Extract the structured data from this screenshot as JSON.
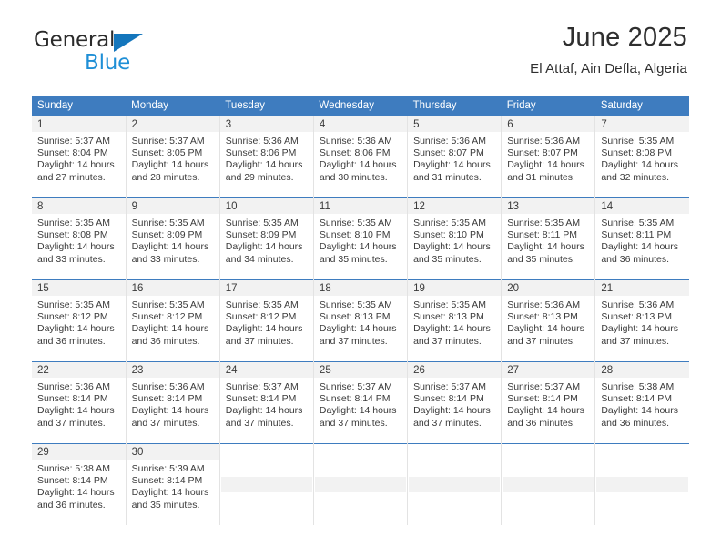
{
  "logo": {
    "name_part1": "General",
    "name_part2": "Blue",
    "triangle_color": "#1476bc",
    "text_color": "#2b2b2b",
    "blue_color": "#1f8fd6"
  },
  "header": {
    "title": "June 2025",
    "subtitle": "El Attaf, Ain Defla, Algeria"
  },
  "theme": {
    "header_row_bg": "#3e7cbf",
    "daynum_bg": "#f2f2f2",
    "grid_line": "#e3e3e3",
    "text": "#3a3a3a"
  },
  "weekday_headers": [
    "Sunday",
    "Monday",
    "Tuesday",
    "Wednesday",
    "Thursday",
    "Friday",
    "Saturday"
  ],
  "weeks": [
    {
      "days": [
        {
          "day": "1",
          "sunrise": "Sunrise: 5:37 AM",
          "sunset": "Sunset: 8:04 PM",
          "daylight1": "Daylight: 14 hours",
          "daylight2": "and 27 minutes."
        },
        {
          "day": "2",
          "sunrise": "Sunrise: 5:37 AM",
          "sunset": "Sunset: 8:05 PM",
          "daylight1": "Daylight: 14 hours",
          "daylight2": "and 28 minutes."
        },
        {
          "day": "3",
          "sunrise": "Sunrise: 5:36 AM",
          "sunset": "Sunset: 8:06 PM",
          "daylight1": "Daylight: 14 hours",
          "daylight2": "and 29 minutes."
        },
        {
          "day": "4",
          "sunrise": "Sunrise: 5:36 AM",
          "sunset": "Sunset: 8:06 PM",
          "daylight1": "Daylight: 14 hours",
          "daylight2": "and 30 minutes."
        },
        {
          "day": "5",
          "sunrise": "Sunrise: 5:36 AM",
          "sunset": "Sunset: 8:07 PM",
          "daylight1": "Daylight: 14 hours",
          "daylight2": "and 31 minutes."
        },
        {
          "day": "6",
          "sunrise": "Sunrise: 5:36 AM",
          "sunset": "Sunset: 8:07 PM",
          "daylight1": "Daylight: 14 hours",
          "daylight2": "and 31 minutes."
        },
        {
          "day": "7",
          "sunrise": "Sunrise: 5:35 AM",
          "sunset": "Sunset: 8:08 PM",
          "daylight1": "Daylight: 14 hours",
          "daylight2": "and 32 minutes."
        }
      ]
    },
    {
      "days": [
        {
          "day": "8",
          "sunrise": "Sunrise: 5:35 AM",
          "sunset": "Sunset: 8:08 PM",
          "daylight1": "Daylight: 14 hours",
          "daylight2": "and 33 minutes."
        },
        {
          "day": "9",
          "sunrise": "Sunrise: 5:35 AM",
          "sunset": "Sunset: 8:09 PM",
          "daylight1": "Daylight: 14 hours",
          "daylight2": "and 33 minutes."
        },
        {
          "day": "10",
          "sunrise": "Sunrise: 5:35 AM",
          "sunset": "Sunset: 8:09 PM",
          "daylight1": "Daylight: 14 hours",
          "daylight2": "and 34 minutes."
        },
        {
          "day": "11",
          "sunrise": "Sunrise: 5:35 AM",
          "sunset": "Sunset: 8:10 PM",
          "daylight1": "Daylight: 14 hours",
          "daylight2": "and 35 minutes."
        },
        {
          "day": "12",
          "sunrise": "Sunrise: 5:35 AM",
          "sunset": "Sunset: 8:10 PM",
          "daylight1": "Daylight: 14 hours",
          "daylight2": "and 35 minutes."
        },
        {
          "day": "13",
          "sunrise": "Sunrise: 5:35 AM",
          "sunset": "Sunset: 8:11 PM",
          "daylight1": "Daylight: 14 hours",
          "daylight2": "and 35 minutes."
        },
        {
          "day": "14",
          "sunrise": "Sunrise: 5:35 AM",
          "sunset": "Sunset: 8:11 PM",
          "daylight1": "Daylight: 14 hours",
          "daylight2": "and 36 minutes."
        }
      ]
    },
    {
      "days": [
        {
          "day": "15",
          "sunrise": "Sunrise: 5:35 AM",
          "sunset": "Sunset: 8:12 PM",
          "daylight1": "Daylight: 14 hours",
          "daylight2": "and 36 minutes."
        },
        {
          "day": "16",
          "sunrise": "Sunrise: 5:35 AM",
          "sunset": "Sunset: 8:12 PM",
          "daylight1": "Daylight: 14 hours",
          "daylight2": "and 36 minutes."
        },
        {
          "day": "17",
          "sunrise": "Sunrise: 5:35 AM",
          "sunset": "Sunset: 8:12 PM",
          "daylight1": "Daylight: 14 hours",
          "daylight2": "and 37 minutes."
        },
        {
          "day": "18",
          "sunrise": "Sunrise: 5:35 AM",
          "sunset": "Sunset: 8:13 PM",
          "daylight1": "Daylight: 14 hours",
          "daylight2": "and 37 minutes."
        },
        {
          "day": "19",
          "sunrise": "Sunrise: 5:35 AM",
          "sunset": "Sunset: 8:13 PM",
          "daylight1": "Daylight: 14 hours",
          "daylight2": "and 37 minutes."
        },
        {
          "day": "20",
          "sunrise": "Sunrise: 5:36 AM",
          "sunset": "Sunset: 8:13 PM",
          "daylight1": "Daylight: 14 hours",
          "daylight2": "and 37 minutes."
        },
        {
          "day": "21",
          "sunrise": "Sunrise: 5:36 AM",
          "sunset": "Sunset: 8:13 PM",
          "daylight1": "Daylight: 14 hours",
          "daylight2": "and 37 minutes."
        }
      ]
    },
    {
      "days": [
        {
          "day": "22",
          "sunrise": "Sunrise: 5:36 AM",
          "sunset": "Sunset: 8:14 PM",
          "daylight1": "Daylight: 14 hours",
          "daylight2": "and 37 minutes."
        },
        {
          "day": "23",
          "sunrise": "Sunrise: 5:36 AM",
          "sunset": "Sunset: 8:14 PM",
          "daylight1": "Daylight: 14 hours",
          "daylight2": "and 37 minutes."
        },
        {
          "day": "24",
          "sunrise": "Sunrise: 5:37 AM",
          "sunset": "Sunset: 8:14 PM",
          "daylight1": "Daylight: 14 hours",
          "daylight2": "and 37 minutes."
        },
        {
          "day": "25",
          "sunrise": "Sunrise: 5:37 AM",
          "sunset": "Sunset: 8:14 PM",
          "daylight1": "Daylight: 14 hours",
          "daylight2": "and 37 minutes."
        },
        {
          "day": "26",
          "sunrise": "Sunrise: 5:37 AM",
          "sunset": "Sunset: 8:14 PM",
          "daylight1": "Daylight: 14 hours",
          "daylight2": "and 37 minutes."
        },
        {
          "day": "27",
          "sunrise": "Sunrise: 5:37 AM",
          "sunset": "Sunset: 8:14 PM",
          "daylight1": "Daylight: 14 hours",
          "daylight2": "and 36 minutes."
        },
        {
          "day": "28",
          "sunrise": "Sunrise: 5:38 AM",
          "sunset": "Sunset: 8:14 PM",
          "daylight1": "Daylight: 14 hours",
          "daylight2": "and 36 minutes."
        }
      ]
    },
    {
      "days": [
        {
          "day": "29",
          "sunrise": "Sunrise: 5:38 AM",
          "sunset": "Sunset: 8:14 PM",
          "daylight1": "Daylight: 14 hours",
          "daylight2": "and 36 minutes."
        },
        {
          "day": "30",
          "sunrise": "Sunrise: 5:39 AM",
          "sunset": "Sunset: 8:14 PM",
          "daylight1": "Daylight: 14 hours",
          "daylight2": "and 35 minutes."
        },
        null,
        null,
        null,
        null,
        null
      ]
    }
  ]
}
